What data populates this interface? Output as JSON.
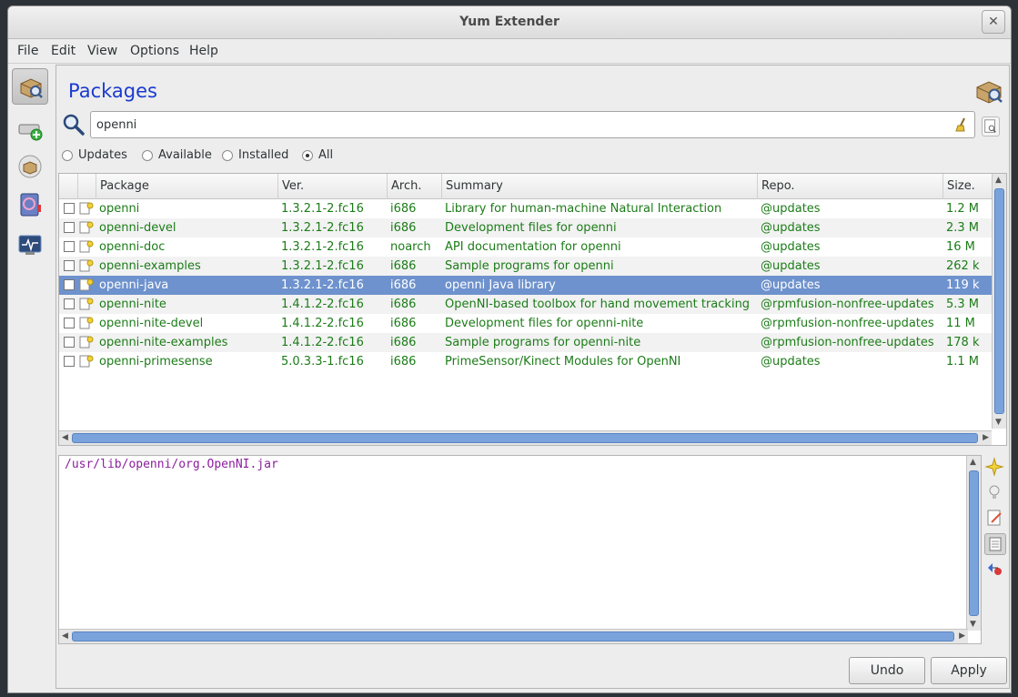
{
  "window": {
    "title": "Yum Extender",
    "close_label": "✕"
  },
  "menu": [
    "File",
    "Edit",
    "View",
    "Options",
    "Help"
  ],
  "page": {
    "title": "Packages"
  },
  "search": {
    "value": "openni"
  },
  "filters": [
    {
      "label": "Updates",
      "checked": false
    },
    {
      "label": "Available",
      "checked": false
    },
    {
      "label": "Installed",
      "checked": false
    },
    {
      "label": "All",
      "checked": true
    }
  ],
  "table": {
    "columns": [
      "Package",
      "Ver.",
      "Arch.",
      "Summary",
      "Repo.",
      "Size."
    ],
    "rows": [
      {
        "package": "openni",
        "ver": "1.3.2.1-2.fc16",
        "arch": "i686",
        "summary": "Library for human-machine Natural Interaction",
        "repo": "@updates",
        "size": "1.2 M"
      },
      {
        "package": "openni-devel",
        "ver": "1.3.2.1-2.fc16",
        "arch": "i686",
        "summary": "Development files for openni",
        "repo": "@updates",
        "size": "2.3 M"
      },
      {
        "package": "openni-doc",
        "ver": "1.3.2.1-2.fc16",
        "arch": "noarch",
        "summary": "API documentation for openni",
        "repo": "@updates",
        "size": "16 M"
      },
      {
        "package": "openni-examples",
        "ver": "1.3.2.1-2.fc16",
        "arch": "i686",
        "summary": "Sample programs for openni",
        "repo": "@updates",
        "size": "262 k"
      },
      {
        "package": "openni-java",
        "ver": "1.3.2.1-2.fc16",
        "arch": "i686",
        "summary": "openni Java library",
        "repo": "@updates",
        "size": "119 k"
      },
      {
        "package": "openni-nite",
        "ver": "1.4.1.2-2.fc16",
        "arch": "i686",
        "summary": "OpenNI-based toolbox for hand movement tracking",
        "repo": "@rpmfusion-nonfree-updates",
        "size": "5.3 M"
      },
      {
        "package": "openni-nite-devel",
        "ver": "1.4.1.2-2.fc16",
        "arch": "i686",
        "summary": "Development files for openni-nite",
        "repo": "@rpmfusion-nonfree-updates",
        "size": "11 M"
      },
      {
        "package": "openni-nite-examples",
        "ver": "1.4.1.2-2.fc16",
        "arch": "i686",
        "summary": "Sample programs for openni-nite",
        "repo": "@rpmfusion-nonfree-updates",
        "size": "178 k"
      },
      {
        "package": "openni-primesense",
        "ver": "5.0.3.3-1.fc16",
        "arch": "i686",
        "summary": "PrimeSensor/Kinect Modules for OpenNI",
        "repo": "@updates",
        "size": "1.1 M"
      }
    ],
    "selected_row": 4
  },
  "details": {
    "text": "/usr/lib/openni/org.OpenNI.jar"
  },
  "buttons": {
    "undo": "Undo",
    "apply": "Apply"
  },
  "colors": {
    "accent": "#1a3bd0",
    "text_green": "#1c7c18",
    "selection": "#6e92cd"
  }
}
